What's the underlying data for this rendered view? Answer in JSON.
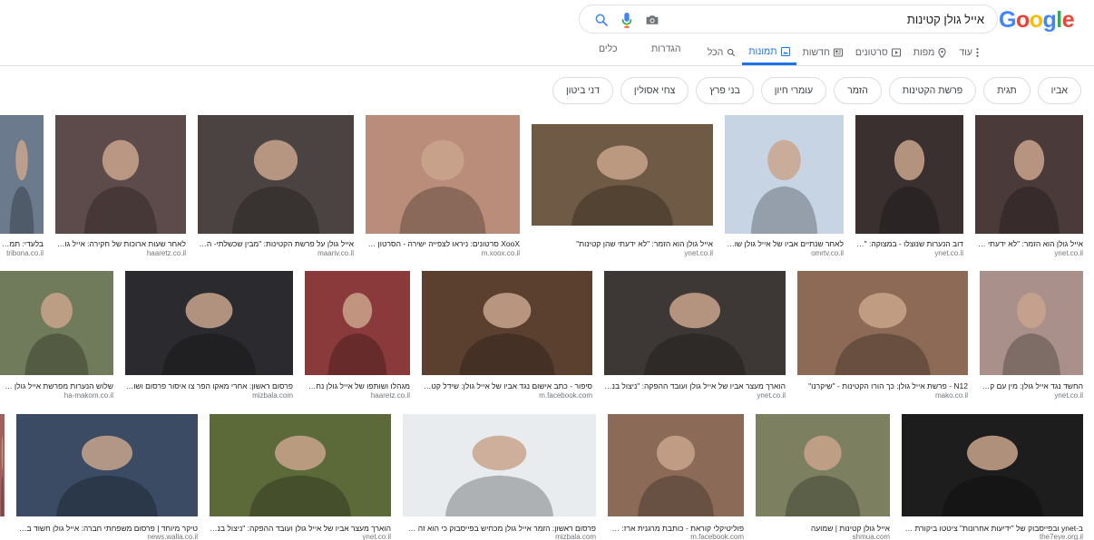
{
  "logo": {
    "letters": [
      "G",
      "o",
      "o",
      "g",
      "l",
      "e"
    ],
    "colors": [
      "#4285F4",
      "#EA4335",
      "#FBBC05",
      "#4285F4",
      "#34A853",
      "#EA4335"
    ]
  },
  "search": {
    "query": "אייל גולן קטינות"
  },
  "tabs": [
    {
      "label": "הכל",
      "icon": "search-icon",
      "active": false
    },
    {
      "label": "תמונות",
      "icon": "image-icon",
      "active": true
    },
    {
      "label": "חדשות",
      "icon": "news-icon",
      "active": false
    },
    {
      "label": "סרטונים",
      "icon": "video-icon",
      "active": false
    },
    {
      "label": "מפות",
      "icon": "pin-icon",
      "active": false
    },
    {
      "label": "עוד",
      "icon": "more-icon",
      "active": false
    }
  ],
  "settings_label": "הגדרות",
  "tools_label": "כלים",
  "chips": [
    "דני ביטון",
    "צחי אסולין",
    "בני פרץ",
    "עומרי חיון",
    "הזמר",
    "פרשת הקטינות",
    "תגית",
    "אביו"
  ],
  "results": [
    {
      "caption": "אייל גולן הוא הזמר: \"לא ידעתי שה...",
      "source": "ynet.co.il",
      "color": "#4a3b3a"
    },
    {
      "caption": "דוב הנערות שנוצלו - במצוקה: \"הי...",
      "source": "ynet.co.il",
      "color": "#3a3030"
    },
    {
      "caption": "לאחר שנתיים אביו של אייל גולן שוחר...",
      "source": "omrtv.co.il",
      "color": "#c7d4e4"
    },
    {
      "caption": "אייל גולן הוא הזמר: \"לא ידעתי שהן קטינות\"",
      "source": "ynet.co.il",
      "color": "#6f5a45"
    },
    {
      "caption": "XooX סרטונים: ניראו לצפייה ישירה - הסרטון של אייל...",
      "source": "m.xoox.co.il",
      "color": "#b98d7a"
    },
    {
      "caption": "אייל גולן על פרשת הקטינות: \"מבין שכשלתי- הייתי...",
      "source": "maariv.co.il",
      "color": "#4b4341"
    },
    {
      "caption": "לאחר שעות ארוכות של חקירה: אייל גולן...",
      "source": "haaretz.co.il",
      "color": "#5c4b4a"
    },
    {
      "caption": "בלעדי: תמונות...",
      "source": "tribona.co.il",
      "color": "#6b7a8c"
    },
    {
      "caption": "החשד נגד אייל גולן: מין עם קטינ...",
      "source": "ynet.co.il",
      "color": "#a9908a"
    },
    {
      "caption": "N12 - פרשת אייל גולן: כך הורו הקטינות - \"שיקרנו\"",
      "source": "mako.co.il",
      "color": "#8c6a55"
    },
    {
      "caption": "הוארך מעצר אביו של אייל גולן ועובד ההפקה: \"ניצול בנות ק...",
      "source": "ynet.co.il",
      "color": "#3d3836"
    },
    {
      "caption": "סיפור - כתב אישום נגד אביו של אייל גולן: שידל קטינות...",
      "source": "m.facebook.com",
      "color": "#5b4030"
    },
    {
      "caption": "מגהלו ושותפו של אייל גולן נחקר...",
      "source": "haaretz.co.il",
      "color": "#8a3a3a"
    },
    {
      "caption": "פרסום ראשון: אחרי מאקו הפר צו איסור פרסום ושוף א...",
      "source": "mizbala.com",
      "color": "#2b2b2f"
    },
    {
      "caption": "שלוש הנערות מפרשת אייל גולן מתכננ...",
      "source": "ha-makom.co.il",
      "color": "#6f7b5a"
    },
    {
      "caption": "ב-ynet ובפייסבוק של \"ידיעות אחרונות\" ציטטו ביקורת חריפ...",
      "source": "the7eye.org.il",
      "color": "#1d1d1d"
    },
    {
      "caption": "אייל גולן קטינות | שמועה",
      "source": "shmua.com",
      "color": "#7d8060"
    },
    {
      "caption": "פוליטיקלי קוראת - כותבת מרגנית ארז: בנו...",
      "source": "m.facebook.com",
      "color": "#8b6b58"
    },
    {
      "caption": "פרסום ראשון: הזמר אייל גולן מכחיש בפייסבוק כי הוא זה שלכו...",
      "source": "mizbala.com",
      "color": "#e9ecef"
    },
    {
      "caption": "הוארך מעצר אביו של אייל גולן ועובד ההפקה: \"ניצול בנות ק...",
      "source": "ynet.co.il",
      "color": "#5c6a3a"
    },
    {
      "caption": "טיקר מיוחד | פרסום משפחתי חברה: אייל גולן חשוד בבעילת...",
      "source": "news.walla.co.il",
      "color": "#3a4b63"
    },
    {
      "caption": "",
      "source": "",
      "color": "#a06060"
    }
  ]
}
